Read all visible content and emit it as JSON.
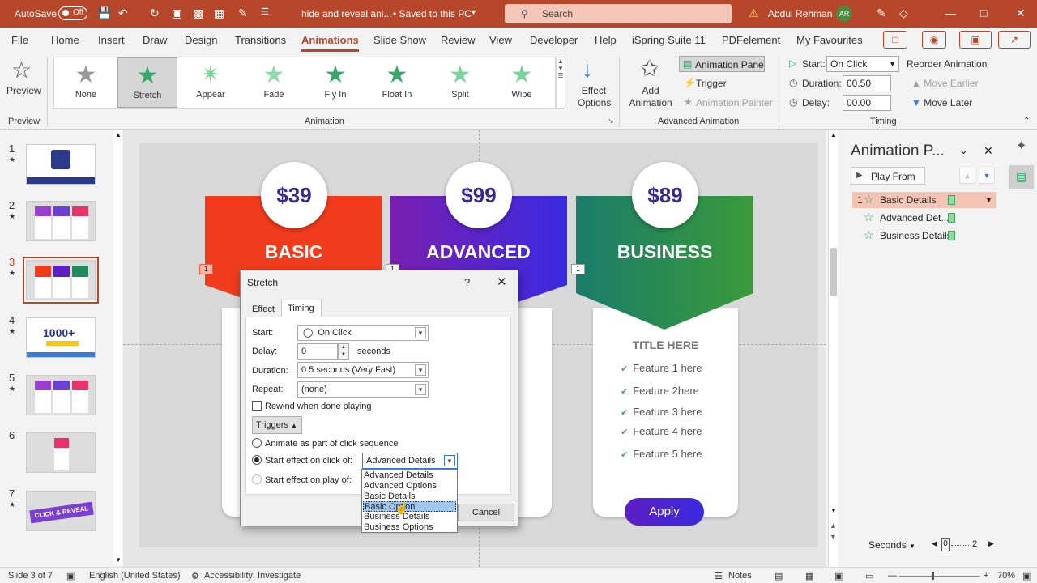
{
  "titlebar": {
    "autosave_label": "AutoSave",
    "autosave_state": "Off",
    "doc_title": "hide and reveal ani...",
    "saved_status": "• Saved to this PC",
    "search_placeholder": "Search",
    "user_name": "Abdul Rehman",
    "user_initials": "AR"
  },
  "menu": [
    "File",
    "Home",
    "Insert",
    "Draw",
    "Design",
    "Transitions",
    "Animations",
    "Slide Show",
    "Review",
    "View",
    "Developer",
    "Help",
    "iSpring Suite 11",
    "PDFelement",
    "My Favourites"
  ],
  "ribbon": {
    "preview_label": "Preview",
    "preview_group": "Preview",
    "gallery": [
      "None",
      "Stretch",
      "Appear",
      "Fade",
      "Fly In",
      "Float In",
      "Split",
      "Wipe"
    ],
    "effect_options": "Effect Options",
    "animation_group": "Animation",
    "add_animation": "Add Animation",
    "animation_pane": "Animation Pane",
    "trigger": "Trigger",
    "animation_painter": "Animation Painter",
    "advanced_group": "Advanced Animation",
    "start_label": "Start:",
    "start_value": "On Click",
    "duration_label": "Duration:",
    "duration_value": "00.50",
    "delay_label": "Delay:",
    "delay_value": "00.00",
    "reorder": "Reorder Animation",
    "move_earlier": "Move Earlier",
    "move_later": "Move Later",
    "timing_group": "Timing"
  },
  "slides": {
    "numbers": [
      "1",
      "2",
      "3",
      "4",
      "5",
      "6",
      "7"
    ],
    "thumb4_text": "1000+",
    "thumb7_text": "CLICK & REVEAL"
  },
  "slide": {
    "cards": [
      {
        "price": "$39",
        "plan": "BASIC",
        "color": "#f03c1c"
      },
      {
        "price": "$99",
        "plan": "ADVANCED",
        "color": "#5b1fc2"
      },
      {
        "price": "$89",
        "plan": "BUSINESS",
        "color": "#1f8a5c"
      }
    ],
    "badges": [
      "1",
      "1",
      "1"
    ],
    "title_here": "TITLE HERE",
    "features": [
      "Feature 1 here",
      "Feature 2here",
      "Feature 3 here",
      "Feature 4 here",
      "Feature 5 here"
    ],
    "apply_label": "Apply"
  },
  "dialog": {
    "title": "Stretch",
    "help": "?",
    "tabs": [
      "Effect",
      "Timing"
    ],
    "start_label": "Start:",
    "start_value": "On Click",
    "delay_label": "Delay:",
    "delay_value": "0",
    "delay_unit": "seconds",
    "duration_label": "Duration:",
    "duration_value": "0.5 seconds (Very Fast)",
    "repeat_label": "Repeat:",
    "repeat_value": "(none)",
    "rewind_label": "Rewind when done playing",
    "triggers_label": "Triggers",
    "animate_part_label": "Animate as part of click sequence",
    "start_click_label": "Start effect on click of:",
    "start_click_value": "Advanced Details",
    "start_play_label": "Start effect on play of:",
    "cancel_label": "Cancel",
    "options": [
      "Advanced Details",
      "Advanced Options",
      "Basic Details",
      "Basic Option",
      "Business Details",
      "Business Options"
    ]
  },
  "anipane": {
    "title": "Animation P...",
    "play_from": "Play From",
    "items": [
      {
        "num": "1",
        "label": "Basic Details"
      },
      {
        "num": "",
        "label": "Advanced Det..."
      },
      {
        "num": "",
        "label": "Business Details"
      }
    ],
    "seconds_label": "Seconds",
    "timeline_start": "0",
    "timeline_end": "2"
  },
  "status": {
    "slide_info": "Slide 3 of 7",
    "language": "English (United States)",
    "accessibility": "Accessibility: Investigate",
    "notes": "Notes",
    "zoom": "70%"
  }
}
